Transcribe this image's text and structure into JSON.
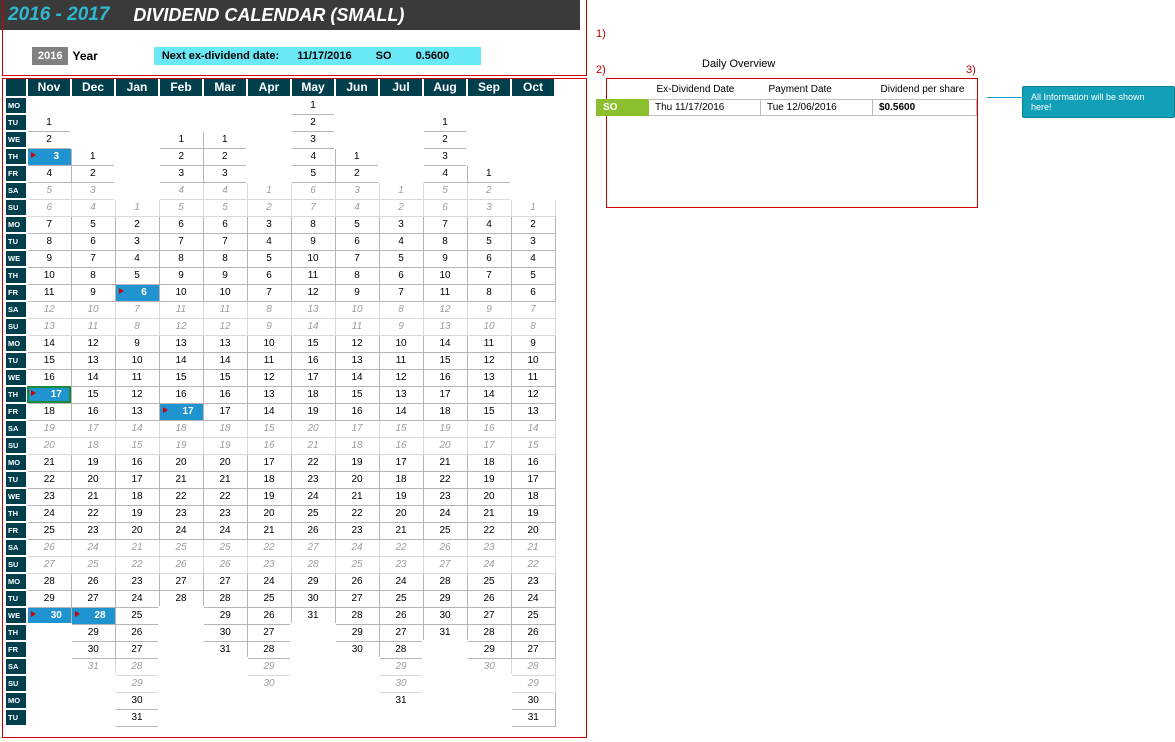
{
  "header": {
    "year_range": "2016 - 2017",
    "title": "DIVIDEND CALENDAR (SMALL)"
  },
  "year_row": {
    "badge": "2016",
    "label": "Year",
    "next_label": "Next ex-dividend date:",
    "next_date": "11/17/2016",
    "next_sym": "SO",
    "next_amt": "0.5600"
  },
  "annotations": {
    "a1": "1)",
    "a2": "2)",
    "a3": "3)"
  },
  "overview": {
    "title": "Daily Overview",
    "cols": {
      "exdate": "Ex-Dividend Date",
      "paydate": "Payment Date",
      "dps": "Dividend per share"
    },
    "rows": [
      {
        "sym": "SO",
        "exdate": "Thu  11/17/2016",
        "paydate": "Tue  12/06/2016",
        "dps": "$0.5600"
      }
    ]
  },
  "callout": "All Information will be shown here!",
  "calendar": {
    "months": [
      "Nov",
      "Dec",
      "Jan",
      "Feb",
      "Mar",
      "Apr",
      "May",
      "Jun",
      "Jul",
      "Aug",
      "Sep",
      "Oct"
    ],
    "day_labels": [
      "MO",
      "TU",
      "WE",
      "TH",
      "FR",
      "SA",
      "SU",
      "MO",
      "TU",
      "WE",
      "TH",
      "FR",
      "SA",
      "SU",
      "MO",
      "TU",
      "WE",
      "TH",
      "FR",
      "SA",
      "SU",
      "MO",
      "TU",
      "WE",
      "TH",
      "FR",
      "SA",
      "SU",
      "MO",
      "TU",
      "WE",
      "TH",
      "FR",
      "SA",
      "SU",
      "MO",
      "TU"
    ],
    "rows": [
      [
        "",
        "",
        "",
        "",
        "",
        "",
        "1",
        "",
        "",
        "",
        "",
        ""
      ],
      [
        "1",
        "",
        "",
        "",
        "",
        "",
        "2",
        "",
        "",
        "1",
        "",
        ""
      ],
      [
        "2",
        "",
        "",
        "1",
        "1",
        "",
        "3",
        "",
        "",
        "2",
        "",
        ""
      ],
      [
        {
          "v": "3",
          "f": 1
        },
        "1",
        "",
        "2",
        "2",
        "",
        "4",
        "1",
        "",
        "3",
        "",
        ""
      ],
      [
        "4",
        "2",
        "",
        "3",
        "3",
        "",
        "5",
        "2",
        "",
        "4",
        "1",
        ""
      ],
      [
        "5",
        "3",
        "",
        "4",
        "4",
        "1",
        "6",
        "3",
        "1",
        "5",
        "2",
        ""
      ],
      [
        "6",
        "4",
        "1",
        "5",
        "5",
        "2",
        "7",
        "4",
        "2",
        "6",
        "3",
        "1"
      ],
      [
        "7",
        "5",
        "2",
        "6",
        "6",
        "3",
        "8",
        "5",
        "3",
        "7",
        "4",
        "2"
      ],
      [
        "8",
        "6",
        "3",
        "7",
        "7",
        "4",
        "9",
        "6",
        "4",
        "8",
        "5",
        "3"
      ],
      [
        "9",
        "7",
        "4",
        "8",
        "8",
        "5",
        "10",
        "7",
        "5",
        "9",
        "6",
        "4"
      ],
      [
        "10",
        "8",
        "5",
        "9",
        "9",
        "6",
        "11",
        "8",
        "6",
        "10",
        "7",
        "5"
      ],
      [
        "11",
        "9",
        {
          "v": "6",
          "f": 1
        },
        "10",
        "10",
        "7",
        "12",
        "9",
        "7",
        "11",
        "8",
        "6"
      ],
      [
        "12",
        "10",
        "7",
        "11",
        "11",
        "8",
        "13",
        "10",
        "8",
        "12",
        "9",
        "7"
      ],
      [
        "13",
        "11",
        "8",
        "12",
        "12",
        "9",
        "14",
        "11",
        "9",
        "13",
        "10",
        "8"
      ],
      [
        "14",
        "12",
        "9",
        "13",
        "13",
        "10",
        "15",
        "12",
        "10",
        "14",
        "11",
        "9"
      ],
      [
        "15",
        "13",
        "10",
        "14",
        "14",
        "11",
        "16",
        "13",
        "11",
        "15",
        "12",
        "10"
      ],
      [
        "16",
        "14",
        "11",
        "15",
        "15",
        "12",
        "17",
        "14",
        "12",
        "16",
        "13",
        "11"
      ],
      [
        {
          "v": "17",
          "f": 1,
          "sel": 1
        },
        "15",
        "12",
        "16",
        "16",
        "13",
        "18",
        "15",
        "13",
        "17",
        "14",
        "12"
      ],
      [
        "18",
        "16",
        "13",
        {
          "v": "17",
          "f": 1
        },
        "17",
        "14",
        "19",
        "16",
        "14",
        "18",
        "15",
        "13"
      ],
      [
        "19",
        "17",
        "14",
        "18",
        "18",
        "15",
        "20",
        "17",
        "15",
        "19",
        "16",
        "14"
      ],
      [
        "20",
        "18",
        "15",
        "19",
        "19",
        "16",
        "21",
        "18",
        "16",
        "20",
        "17",
        "15"
      ],
      [
        "21",
        "19",
        "16",
        "20",
        "20",
        "17",
        "22",
        "19",
        "17",
        "21",
        "18",
        "16"
      ],
      [
        "22",
        "20",
        "17",
        "21",
        "21",
        "18",
        "23",
        "20",
        "18",
        "22",
        "19",
        "17"
      ],
      [
        "23",
        "21",
        "18",
        "22",
        "22",
        "19",
        "24",
        "21",
        "19",
        "23",
        "20",
        "18"
      ],
      [
        "24",
        "22",
        "19",
        "23",
        "23",
        "20",
        "25",
        "22",
        "20",
        "24",
        "21",
        "19"
      ],
      [
        "25",
        "23",
        "20",
        "24",
        "24",
        "21",
        "26",
        "23",
        "21",
        "25",
        "22",
        "20"
      ],
      [
        "26",
        "24",
        "21",
        "25",
        "25",
        "22",
        "27",
        "24",
        "22",
        "26",
        "23",
        "21"
      ],
      [
        "27",
        "25",
        "22",
        "26",
        "26",
        "23",
        "28",
        "25",
        "23",
        "27",
        "24",
        "22"
      ],
      [
        "28",
        "26",
        "23",
        "27",
        "27",
        "24",
        "29",
        "26",
        "24",
        "28",
        "25",
        "23"
      ],
      [
        "29",
        "27",
        "24",
        "28",
        "28",
        "25",
        "30",
        "27",
        "25",
        "29",
        "26",
        "24"
      ],
      [
        {
          "v": "30",
          "f": 1
        },
        {
          "v": "28",
          "f": 1
        },
        "25",
        "",
        "29",
        "26",
        "31",
        "28",
        "26",
        "30",
        "27",
        "25"
      ],
      [
        "",
        "29",
        "26",
        "",
        "30",
        "27",
        "",
        "29",
        "27",
        "31",
        "28",
        "26"
      ],
      [
        "",
        "30",
        "27",
        "",
        "31",
        "28",
        "",
        "30",
        "28",
        "",
        "29",
        "27"
      ],
      [
        "",
        "31",
        "28",
        "",
        "",
        "29",
        "",
        "",
        "29",
        "",
        "30",
        "28"
      ],
      [
        "",
        "",
        "29",
        "",
        "",
        "30",
        "",
        "",
        "30",
        "",
        "",
        "29"
      ],
      [
        "",
        "",
        "30",
        "",
        "",
        "",
        "",
        "",
        "31",
        "",
        "",
        "30"
      ],
      [
        "",
        "",
        "31",
        "",
        "",
        "",
        "",
        "",
        "",
        "",
        "",
        "31"
      ]
    ]
  }
}
